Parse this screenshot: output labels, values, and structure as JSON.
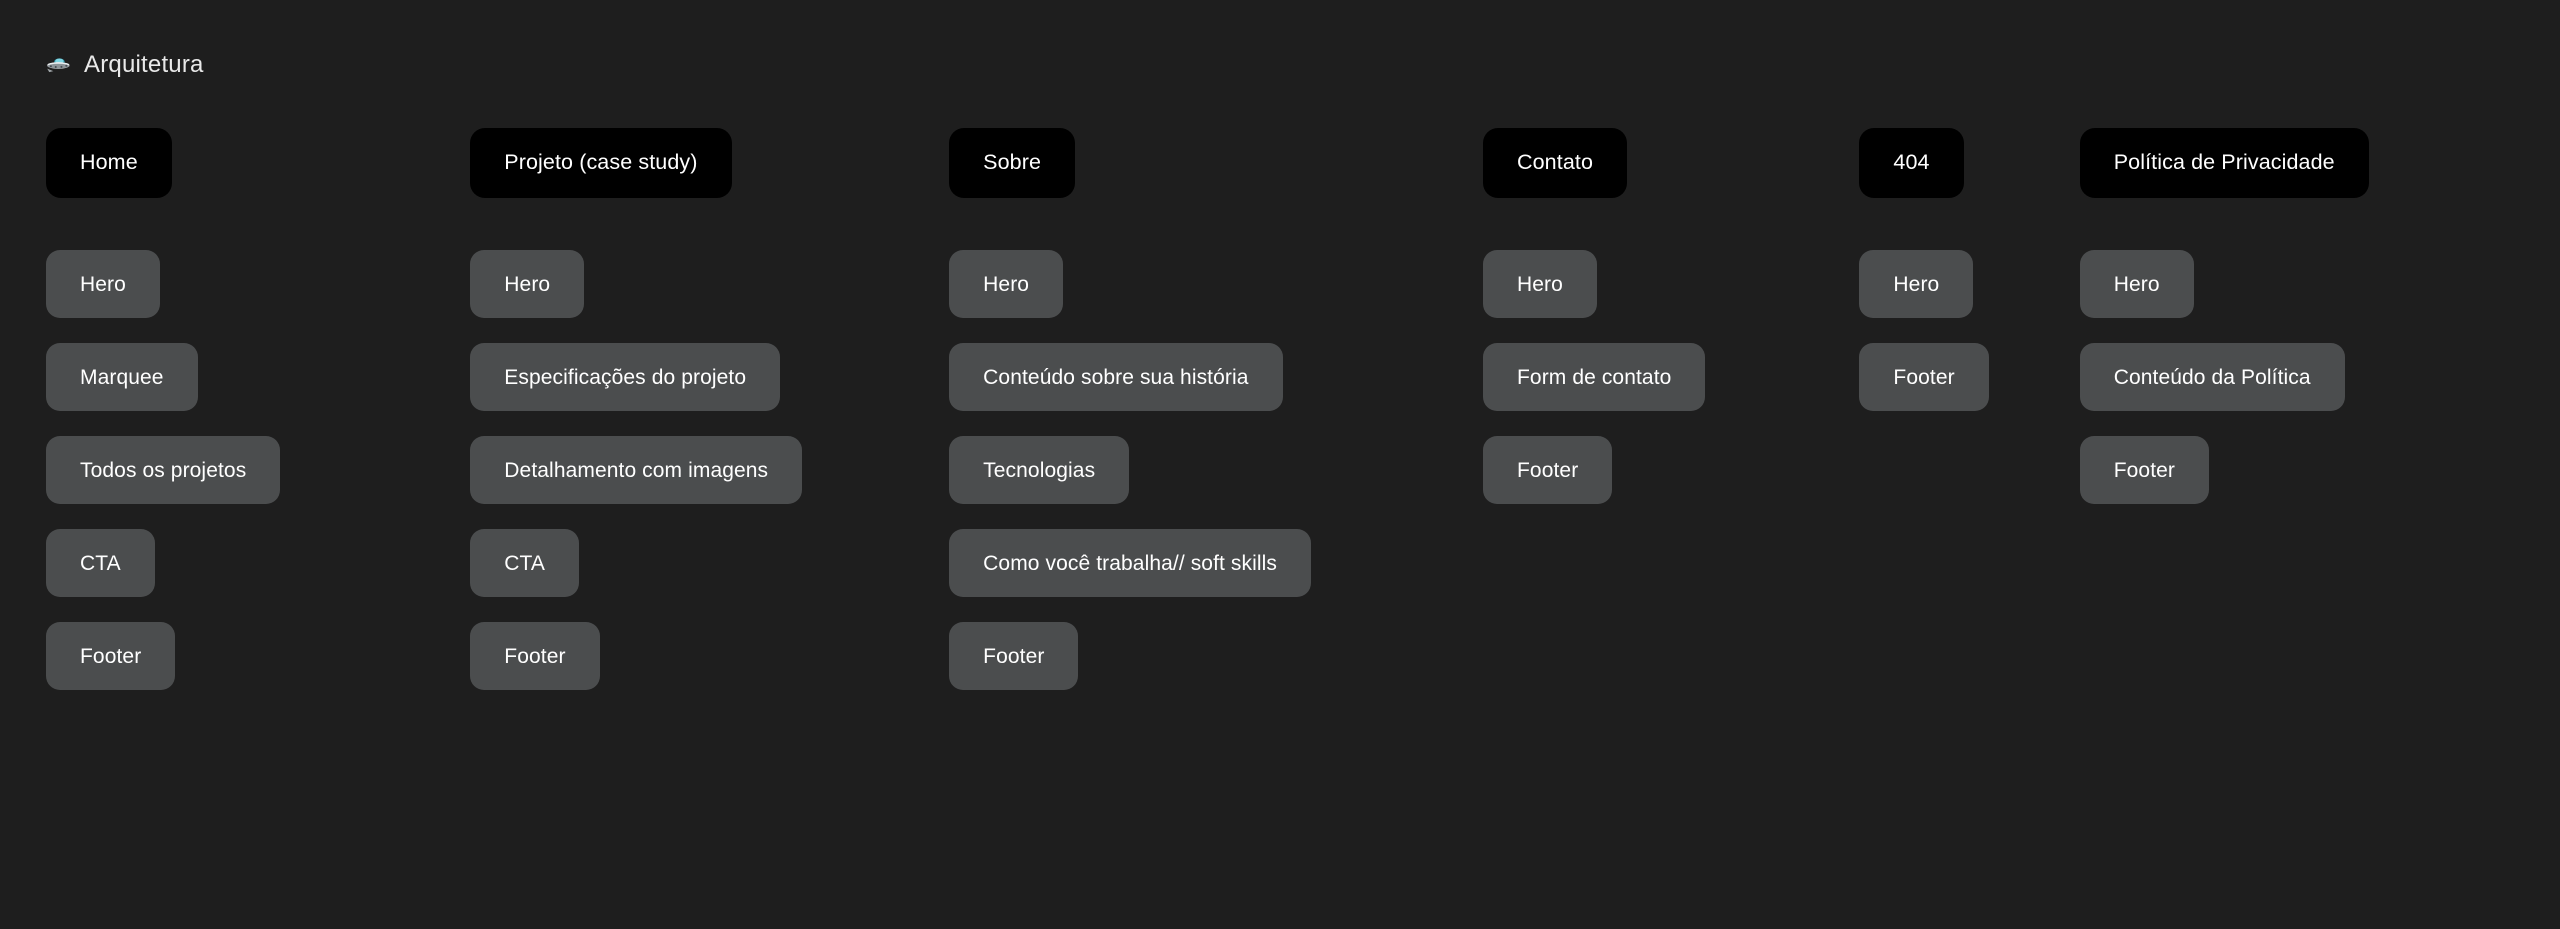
{
  "board": {
    "title": "Arquitetura",
    "title_icon": "ufo-icon",
    "background_color": "#1e1e1e",
    "page_card_color": "#000000",
    "section_card_color": "#4b4d4e",
    "text_color": "#ffffff"
  },
  "columns": [
    {
      "page": "Home",
      "sections": [
        {
          "label": "Hero"
        },
        {
          "label": "Marquee"
        },
        {
          "label": "Todos os projetos"
        },
        {
          "label": "CTA"
        },
        {
          "label": "Footer"
        }
      ]
    },
    {
      "page": "Projeto (case study)",
      "sections": [
        {
          "label": "Hero"
        },
        {
          "label": "Especificações do projeto"
        },
        {
          "label": "Detalhamento com imagens"
        },
        {
          "label": "CTA"
        },
        {
          "label": "Footer"
        }
      ]
    },
    {
      "page": "Sobre",
      "sections": [
        {
          "label": "Hero"
        },
        {
          "label": "Conteúdo sobre sua história"
        },
        {
          "label": "Tecnologias"
        },
        {
          "label": "Como você trabalha// soft skills"
        },
        {
          "label": "Footer"
        }
      ]
    },
    {
      "page": "Contato",
      "sections": [
        {
          "label": "Hero"
        },
        {
          "label": "Form de contato"
        },
        {
          "label": "Footer"
        }
      ]
    },
    {
      "page": "404",
      "sections": [
        {
          "label": "Hero"
        },
        {
          "label": "Footer"
        }
      ]
    },
    {
      "page": "Política de Privacidade",
      "sections": [
        {
          "label": "Hero"
        },
        {
          "label": "Conteúdo da Política"
        },
        {
          "label": "Footer"
        }
      ]
    }
  ]
}
